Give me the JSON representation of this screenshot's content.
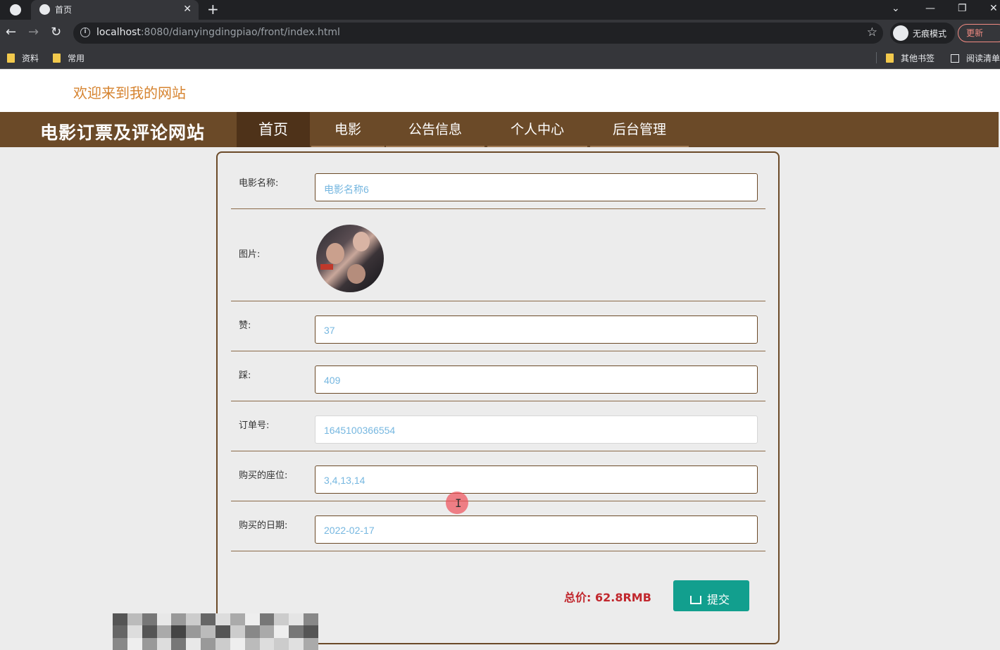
{
  "browser": {
    "tab_title": "首页",
    "url_host": "localhost",
    "url_rest": ":8080/dianyingdingpiao/front/index.html",
    "incognito_label": "无痕模式",
    "update_label": "更新",
    "bookmarks": [
      "资料",
      "常用"
    ],
    "bookmarks_right": [
      "其他书签",
      "阅读清单"
    ]
  },
  "site": {
    "welcome": "欢迎来到我的网站",
    "title": "电影订票及评论网站",
    "nav": [
      "首页",
      "电影",
      "公告信息",
      "个人中心",
      "后台管理"
    ],
    "active_nav": "首页"
  },
  "form": {
    "movie_name": {
      "label": "电影名称:",
      "value": "电影名称6"
    },
    "image": {
      "label": "图片:"
    },
    "likes": {
      "label": "赞:",
      "value": "37"
    },
    "dislikes": {
      "label": "踩:",
      "value": "409"
    },
    "order_no": {
      "label": "订单号:",
      "value": "1645100366554"
    },
    "seats": {
      "label": "购买的座位:",
      "value": "3,4,13,14"
    },
    "date": {
      "label": "购买的日期:",
      "value": "2022-02-17"
    },
    "total": "总价: 62.8RMB",
    "submit_label": "提交"
  },
  "colors": {
    "nav_bg": "#6b4a28",
    "welcome_text": "#d6832f",
    "input_text": "#76b7e0",
    "submit_bg": "#129f8e",
    "total_text": "#c1272d"
  }
}
